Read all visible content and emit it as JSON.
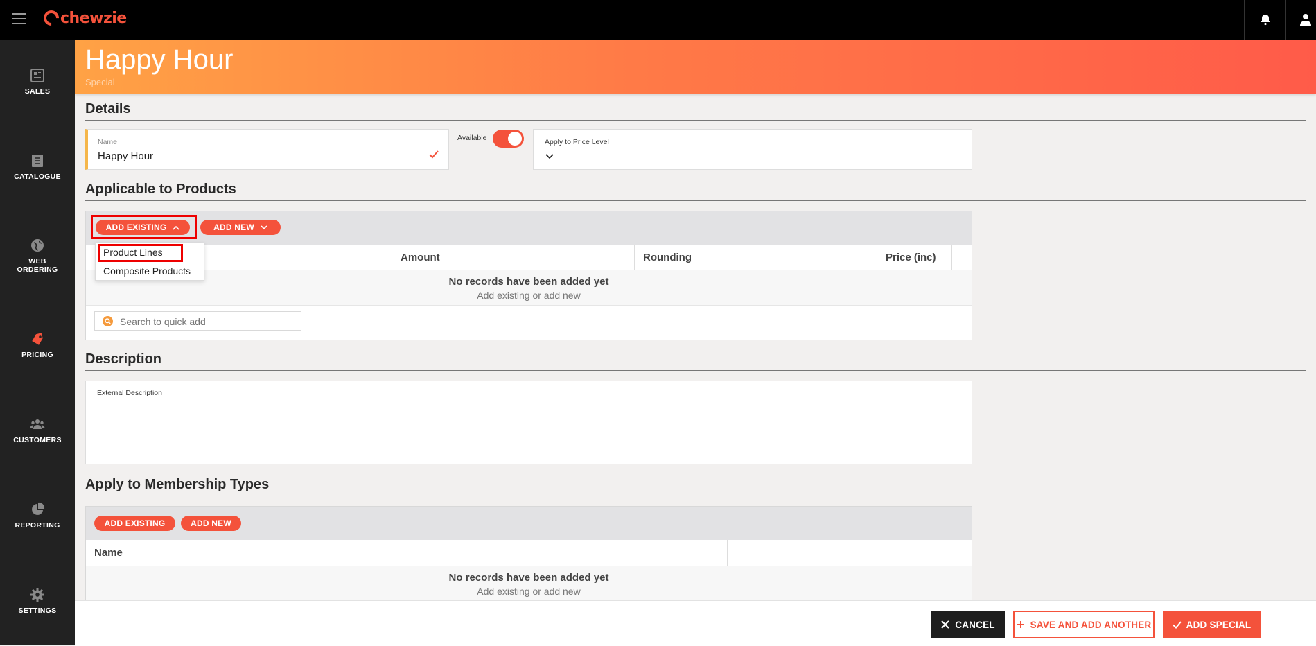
{
  "app": {
    "logo_text": "chewzie"
  },
  "sidebar": {
    "items": [
      {
        "label": "SALES",
        "icon": "sales-icon"
      },
      {
        "label": "CATALOGUE",
        "icon": "catalogue-icon"
      },
      {
        "label": "WEB ORDERING",
        "icon": "globe-icon"
      },
      {
        "label": "PRICING",
        "icon": "tag-icon",
        "active": true
      },
      {
        "label": "CUSTOMERS",
        "icon": "users-icon"
      },
      {
        "label": "REPORTING",
        "icon": "pie-chart-icon"
      },
      {
        "label": "SETTINGS",
        "icon": "gear-icon"
      }
    ]
  },
  "header": {
    "title": "Happy Hour",
    "subtitle": "Special"
  },
  "details": {
    "heading": "Details",
    "name_label": "Name",
    "name_value": "Happy Hour",
    "available_label": "Available",
    "available": true,
    "price_level_label": "Apply to Price Level"
  },
  "products": {
    "heading": "Applicable to Products",
    "add_existing": "ADD EXISTING",
    "add_new": "ADD NEW",
    "dropdown": [
      "Product Lines",
      "Composite Products"
    ],
    "columns": [
      "Amount",
      "Rounding",
      "Price (inc)"
    ],
    "empty_title": "No records have been added yet",
    "empty_sub": "Add existing or add new",
    "search_placeholder": "Search to quick add"
  },
  "description": {
    "heading": "Description",
    "external_label": "External Description"
  },
  "membership": {
    "heading": "Apply to Membership Types",
    "add_existing": "ADD EXISTING",
    "add_new": "ADD NEW",
    "columns": [
      "Name"
    ],
    "empty_title": "No records have been added yet",
    "empty_sub": "Add existing or add new"
  },
  "footer": {
    "cancel": "CANCEL",
    "save_add_another": "SAVE AND ADD ANOTHER",
    "add_special": "ADD SPECIAL"
  },
  "colors": {
    "accent": "#f4523b",
    "sidebar": "#222222",
    "topbar": "#000000"
  }
}
